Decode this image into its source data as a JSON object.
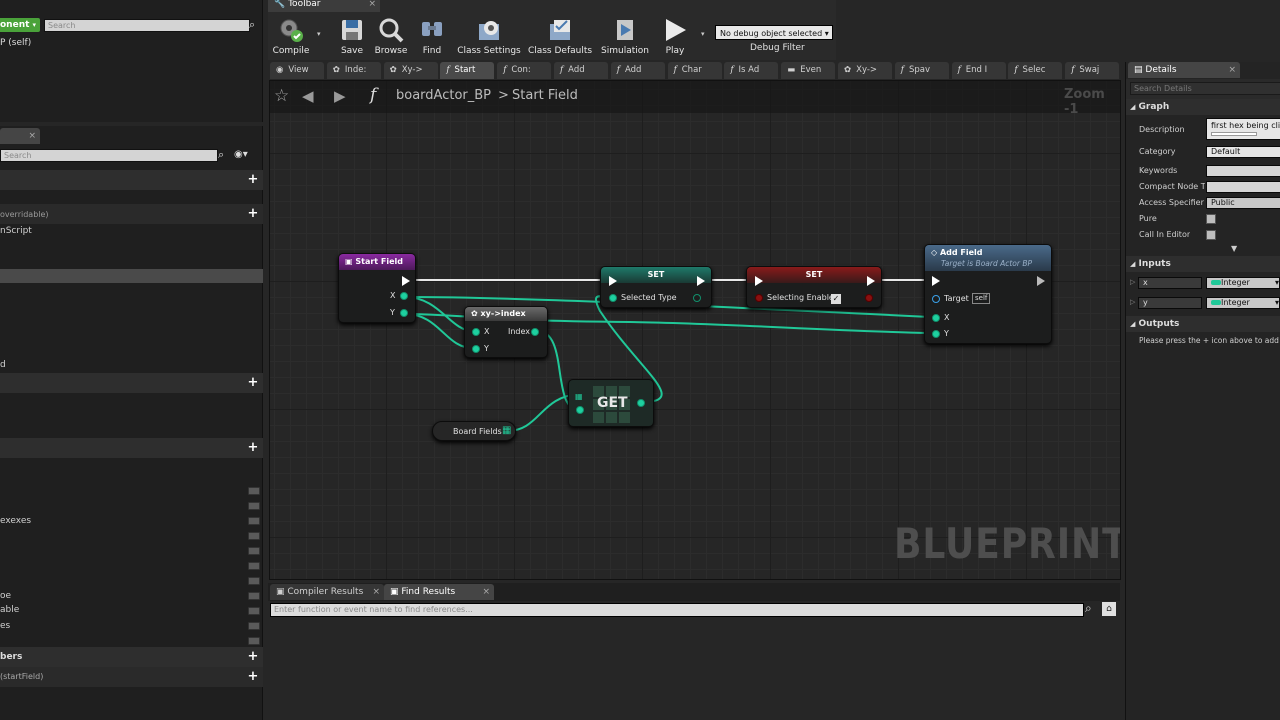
{
  "left": {
    "top_tab": "",
    "component_button": "onent",
    "search_placeholder": "Search",
    "self_item": "P (self)",
    "tab2": "",
    "search2_placeholder": "Search",
    "overridable": "overridable)",
    "construction": "nScript",
    "items": [
      "d",
      "exexes",
      "oe",
      "able",
      "es"
    ],
    "section_members": "bers",
    "bottom_item": "(startField)"
  },
  "toolbar": {
    "tab_label": "Toolbar",
    "compile": "Compile",
    "save": "Save",
    "browse": "Browse",
    "find": "Find",
    "class_settings": "Class Settings",
    "class_defaults": "Class Defaults",
    "simulation": "Simulation",
    "play": "Play",
    "debug_select": "No debug object selected",
    "debug_filter": "Debug Filter"
  },
  "graph_tabs": [
    {
      "icon": "eye",
      "label": "View"
    },
    {
      "icon": "gear",
      "label": "Inde:"
    },
    {
      "icon": "gear",
      "label": "Xy->"
    },
    {
      "icon": "f",
      "label": "Start"
    },
    {
      "icon": "f",
      "label": "Con:"
    },
    {
      "icon": "f",
      "label": "Add"
    },
    {
      "icon": "f",
      "label": "Add"
    },
    {
      "icon": "f",
      "label": "Char"
    },
    {
      "icon": "f",
      "label": "Is Ad"
    },
    {
      "icon": "event",
      "label": "Even"
    },
    {
      "icon": "gear",
      "label": "Xy->"
    },
    {
      "icon": "f",
      "label": "Spav"
    },
    {
      "icon": "f",
      "label": "End I"
    },
    {
      "icon": "f",
      "label": "Selec"
    },
    {
      "icon": "f",
      "label": "Swaj"
    }
  ],
  "graph": {
    "breadcrumb_root": "boardActor_BP",
    "breadcrumb_sep": ">",
    "breadcrumb_current": "Start Field",
    "zoom": "Zoom -1",
    "watermark": "BLUEPRINT",
    "nodes": {
      "start_field": {
        "title": "Start Field",
        "pin_x": "X",
        "pin_y": "Y"
      },
      "xy_index": {
        "title": "xy->index",
        "pin_x": "X",
        "pin_y": "Y",
        "pin_index": "Index"
      },
      "set1": {
        "title": "SET",
        "pin": "Selected Type"
      },
      "set2": {
        "title": "SET",
        "pin": "Selecting Enable"
      },
      "add_field": {
        "title": "Add Field",
        "subtitle": "Target is Board Actor BP",
        "pin_target": "Target",
        "target_value": "self",
        "pin_x": "X",
        "pin_y": "Y"
      },
      "get": {
        "title": "GET"
      },
      "board_fields": {
        "title": "Board Fields"
      }
    }
  },
  "bottom": {
    "tab1": "Compiler Results",
    "tab2": "Find Results",
    "find_placeholder": "Enter function or event name to find references..."
  },
  "details": {
    "tab": "Details",
    "search_placeholder": "Search Details",
    "graph_section": "Graph",
    "description_label": "Description",
    "description_value": "first hex being click",
    "category_label": "Category",
    "category_value": "Default",
    "keywords_label": "Keywords",
    "compact_label": "Compact Node T",
    "access_label": "Access Specifier",
    "access_value": "Public",
    "pure_label": "Pure",
    "call_label": "Call In Editor",
    "inputs_section": "Inputs",
    "input_x": "x",
    "input_y": "y",
    "input_type": "Integer",
    "outputs_section": "Outputs",
    "outputs_hint": "Please press the + icon above to add p"
  }
}
